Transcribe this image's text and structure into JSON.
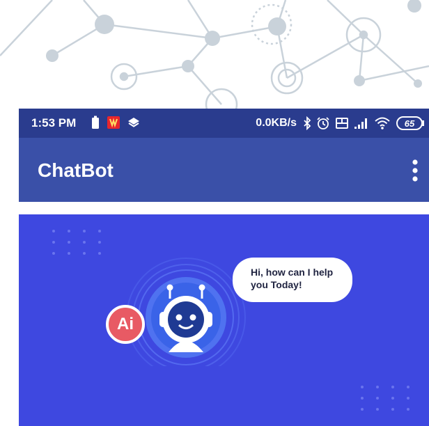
{
  "status_bar": {
    "time": "1:53 PM",
    "net_speed": "0.0KB/s",
    "battery": "65",
    "left_icons": [
      "battery-saver-icon",
      "app-notification-icon",
      "layers-icon"
    ],
    "right_icons": [
      "bluetooth-icon",
      "alarm-icon",
      "volte-icon",
      "signal-icon",
      "wifi-icon",
      "battery-icon"
    ]
  },
  "app_bar": {
    "title": "ChatBot",
    "menu_icon": "more-vert-icon"
  },
  "banner": {
    "speech_bubble": "Hi, how can I help you Today!",
    "ai_badge": "Ai",
    "robot_icon": "robot-icon"
  },
  "colors": {
    "status_bar": "#2a3c8e",
    "app_bar": "#3a50a8",
    "banner": "#3e48e0",
    "ai_badge": "#e85a64"
  }
}
